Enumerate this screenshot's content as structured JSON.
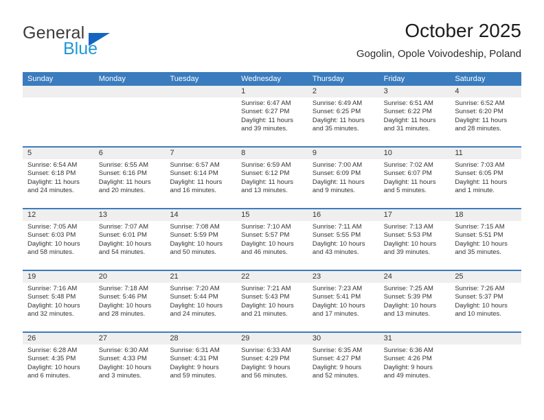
{
  "brand": {
    "name_part1": "General",
    "name_part2": "Blue",
    "triangle_color": "#1565c0",
    "blue_color": "#2196d6"
  },
  "header": {
    "title": "October 2025",
    "subtitle": "Gogolin, Opole Voivodeship, Poland"
  },
  "calendar": {
    "header_bg": "#3a7cbe",
    "day_strip_bg": "#efefef",
    "weekdays": [
      "Sunday",
      "Monday",
      "Tuesday",
      "Wednesday",
      "Thursday",
      "Friday",
      "Saturday"
    ],
    "weeks": [
      [
        {
          "day": "",
          "sunrise": "",
          "sunset": "",
          "daylight_line1": "",
          "daylight_line2": ""
        },
        {
          "day": "",
          "sunrise": "",
          "sunset": "",
          "daylight_line1": "",
          "daylight_line2": ""
        },
        {
          "day": "",
          "sunrise": "",
          "sunset": "",
          "daylight_line1": "",
          "daylight_line2": ""
        },
        {
          "day": "1",
          "sunrise": "Sunrise: 6:47 AM",
          "sunset": "Sunset: 6:27 PM",
          "daylight_line1": "Daylight: 11 hours",
          "daylight_line2": "and 39 minutes."
        },
        {
          "day": "2",
          "sunrise": "Sunrise: 6:49 AM",
          "sunset": "Sunset: 6:25 PM",
          "daylight_line1": "Daylight: 11 hours",
          "daylight_line2": "and 35 minutes."
        },
        {
          "day": "3",
          "sunrise": "Sunrise: 6:51 AM",
          "sunset": "Sunset: 6:22 PM",
          "daylight_line1": "Daylight: 11 hours",
          "daylight_line2": "and 31 minutes."
        },
        {
          "day": "4",
          "sunrise": "Sunrise: 6:52 AM",
          "sunset": "Sunset: 6:20 PM",
          "daylight_line1": "Daylight: 11 hours",
          "daylight_line2": "and 28 minutes."
        }
      ],
      [
        {
          "day": "5",
          "sunrise": "Sunrise: 6:54 AM",
          "sunset": "Sunset: 6:18 PM",
          "daylight_line1": "Daylight: 11 hours",
          "daylight_line2": "and 24 minutes."
        },
        {
          "day": "6",
          "sunrise": "Sunrise: 6:55 AM",
          "sunset": "Sunset: 6:16 PM",
          "daylight_line1": "Daylight: 11 hours",
          "daylight_line2": "and 20 minutes."
        },
        {
          "day": "7",
          "sunrise": "Sunrise: 6:57 AM",
          "sunset": "Sunset: 6:14 PM",
          "daylight_line1": "Daylight: 11 hours",
          "daylight_line2": "and 16 minutes."
        },
        {
          "day": "8",
          "sunrise": "Sunrise: 6:59 AM",
          "sunset": "Sunset: 6:12 PM",
          "daylight_line1": "Daylight: 11 hours",
          "daylight_line2": "and 13 minutes."
        },
        {
          "day": "9",
          "sunrise": "Sunrise: 7:00 AM",
          "sunset": "Sunset: 6:09 PM",
          "daylight_line1": "Daylight: 11 hours",
          "daylight_line2": "and 9 minutes."
        },
        {
          "day": "10",
          "sunrise": "Sunrise: 7:02 AM",
          "sunset": "Sunset: 6:07 PM",
          "daylight_line1": "Daylight: 11 hours",
          "daylight_line2": "and 5 minutes."
        },
        {
          "day": "11",
          "sunrise": "Sunrise: 7:03 AM",
          "sunset": "Sunset: 6:05 PM",
          "daylight_line1": "Daylight: 11 hours",
          "daylight_line2": "and 1 minute."
        }
      ],
      [
        {
          "day": "12",
          "sunrise": "Sunrise: 7:05 AM",
          "sunset": "Sunset: 6:03 PM",
          "daylight_line1": "Daylight: 10 hours",
          "daylight_line2": "and 58 minutes."
        },
        {
          "day": "13",
          "sunrise": "Sunrise: 7:07 AM",
          "sunset": "Sunset: 6:01 PM",
          "daylight_line1": "Daylight: 10 hours",
          "daylight_line2": "and 54 minutes."
        },
        {
          "day": "14",
          "sunrise": "Sunrise: 7:08 AM",
          "sunset": "Sunset: 5:59 PM",
          "daylight_line1": "Daylight: 10 hours",
          "daylight_line2": "and 50 minutes."
        },
        {
          "day": "15",
          "sunrise": "Sunrise: 7:10 AM",
          "sunset": "Sunset: 5:57 PM",
          "daylight_line1": "Daylight: 10 hours",
          "daylight_line2": "and 46 minutes."
        },
        {
          "day": "16",
          "sunrise": "Sunrise: 7:11 AM",
          "sunset": "Sunset: 5:55 PM",
          "daylight_line1": "Daylight: 10 hours",
          "daylight_line2": "and 43 minutes."
        },
        {
          "day": "17",
          "sunrise": "Sunrise: 7:13 AM",
          "sunset": "Sunset: 5:53 PM",
          "daylight_line1": "Daylight: 10 hours",
          "daylight_line2": "and 39 minutes."
        },
        {
          "day": "18",
          "sunrise": "Sunrise: 7:15 AM",
          "sunset": "Sunset: 5:51 PM",
          "daylight_line1": "Daylight: 10 hours",
          "daylight_line2": "and 35 minutes."
        }
      ],
      [
        {
          "day": "19",
          "sunrise": "Sunrise: 7:16 AM",
          "sunset": "Sunset: 5:48 PM",
          "daylight_line1": "Daylight: 10 hours",
          "daylight_line2": "and 32 minutes."
        },
        {
          "day": "20",
          "sunrise": "Sunrise: 7:18 AM",
          "sunset": "Sunset: 5:46 PM",
          "daylight_line1": "Daylight: 10 hours",
          "daylight_line2": "and 28 minutes."
        },
        {
          "day": "21",
          "sunrise": "Sunrise: 7:20 AM",
          "sunset": "Sunset: 5:44 PM",
          "daylight_line1": "Daylight: 10 hours",
          "daylight_line2": "and 24 minutes."
        },
        {
          "day": "22",
          "sunrise": "Sunrise: 7:21 AM",
          "sunset": "Sunset: 5:43 PM",
          "daylight_line1": "Daylight: 10 hours",
          "daylight_line2": "and 21 minutes."
        },
        {
          "day": "23",
          "sunrise": "Sunrise: 7:23 AM",
          "sunset": "Sunset: 5:41 PM",
          "daylight_line1": "Daylight: 10 hours",
          "daylight_line2": "and 17 minutes."
        },
        {
          "day": "24",
          "sunrise": "Sunrise: 7:25 AM",
          "sunset": "Sunset: 5:39 PM",
          "daylight_line1": "Daylight: 10 hours",
          "daylight_line2": "and 13 minutes."
        },
        {
          "day": "25",
          "sunrise": "Sunrise: 7:26 AM",
          "sunset": "Sunset: 5:37 PM",
          "daylight_line1": "Daylight: 10 hours",
          "daylight_line2": "and 10 minutes."
        }
      ],
      [
        {
          "day": "26",
          "sunrise": "Sunrise: 6:28 AM",
          "sunset": "Sunset: 4:35 PM",
          "daylight_line1": "Daylight: 10 hours",
          "daylight_line2": "and 6 minutes."
        },
        {
          "day": "27",
          "sunrise": "Sunrise: 6:30 AM",
          "sunset": "Sunset: 4:33 PM",
          "daylight_line1": "Daylight: 10 hours",
          "daylight_line2": "and 3 minutes."
        },
        {
          "day": "28",
          "sunrise": "Sunrise: 6:31 AM",
          "sunset": "Sunset: 4:31 PM",
          "daylight_line1": "Daylight: 9 hours",
          "daylight_line2": "and 59 minutes."
        },
        {
          "day": "29",
          "sunrise": "Sunrise: 6:33 AM",
          "sunset": "Sunset: 4:29 PM",
          "daylight_line1": "Daylight: 9 hours",
          "daylight_line2": "and 56 minutes."
        },
        {
          "day": "30",
          "sunrise": "Sunrise: 6:35 AM",
          "sunset": "Sunset: 4:27 PM",
          "daylight_line1": "Daylight: 9 hours",
          "daylight_line2": "and 52 minutes."
        },
        {
          "day": "31",
          "sunrise": "Sunrise: 6:36 AM",
          "sunset": "Sunset: 4:26 PM",
          "daylight_line1": "Daylight: 9 hours",
          "daylight_line2": "and 49 minutes."
        },
        {
          "day": "",
          "sunrise": "",
          "sunset": "",
          "daylight_line1": "",
          "daylight_line2": ""
        }
      ]
    ]
  }
}
